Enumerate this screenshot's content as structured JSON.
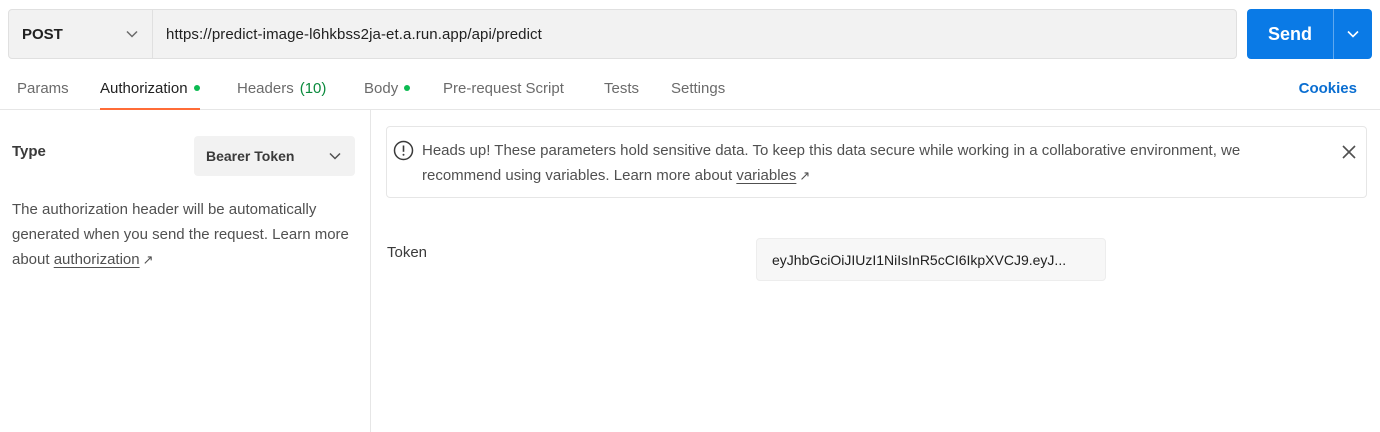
{
  "request": {
    "method": "POST",
    "url": "https://predict-image-l6hkbss2ja-et.a.run.app/api/predict",
    "send_label": "Send"
  },
  "tabs": [
    {
      "label": "Params",
      "active": false
    },
    {
      "label": "Authorization",
      "active": true,
      "dot": true
    },
    {
      "label": "Headers",
      "count": "(10)",
      "active": false
    },
    {
      "label": "Body",
      "active": false,
      "dot": true
    },
    {
      "label": "Pre-request Script",
      "active": false
    },
    {
      "label": "Tests",
      "active": false
    },
    {
      "label": "Settings",
      "active": false
    }
  ],
  "cookies_label": "Cookies",
  "auth": {
    "type_label": "Type",
    "type_value": "Bearer Token",
    "description": "The authorization header will be automatically generated when you send the request. Learn more about",
    "link_text": "authorization"
  },
  "warning": {
    "text": "Heads up! These parameters hold sensitive data. To keep this data secure while working in a collaborative environment, we recommend using variables. Learn more about",
    "link_text": "variables"
  },
  "token": {
    "label": "Token",
    "value": "eyJhbGciOiJIUzI1NiIsInR5cCI6IkpXVCJ9.eyJ..."
  },
  "colors": {
    "accent": "#0a7ae6",
    "active_tab_underline": "#ff6c37",
    "dot_green": "#0cbb52",
    "link_blue": "#0a6ed1"
  },
  "icons": {
    "method_dropdown": "chevron-down-icon",
    "send_dropdown": "chevron-down-icon",
    "type_dropdown": "chevron-down-icon",
    "warning": "alert-circle-icon",
    "close": "close-icon",
    "external_link": "arrow-up-right-icon"
  }
}
